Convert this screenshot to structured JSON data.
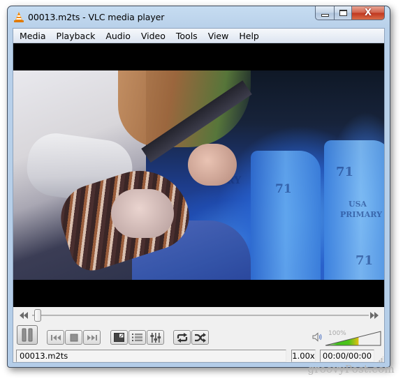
{
  "window": {
    "title": "00013.m2ts - VLC media player",
    "app_icon": "vlc-cone-icon",
    "controls": {
      "minimize_icon": "minimize-icon",
      "maximize_icon": "maximize-icon",
      "close_icon": "close-icon",
      "close_glyph": "X"
    }
  },
  "menubar": {
    "items": [
      {
        "label": "Media"
      },
      {
        "label": "Playback"
      },
      {
        "label": "Audio"
      },
      {
        "label": "Video"
      },
      {
        "label": "Tools"
      },
      {
        "label": "View"
      },
      {
        "label": "Help"
      }
    ]
  },
  "video": {
    "description": "Guitarist playing electric guitar on stage under blue light",
    "amp_labels": [
      "71",
      "71",
      "USA",
      "PRIMARY",
      "71",
      "RY"
    ]
  },
  "seekbar": {
    "position": 0.0,
    "back_icon": "seek-backward-icon",
    "forward_icon": "seek-forward-icon"
  },
  "controls": {
    "buttons": [
      {
        "name": "pause",
        "icon": "pause-icon"
      },
      {
        "name": "previous",
        "icon": "previous-icon"
      },
      {
        "name": "stop",
        "icon": "stop-icon"
      },
      {
        "name": "next",
        "icon": "next-icon"
      },
      {
        "name": "fullscreen",
        "icon": "fullscreen-icon"
      },
      {
        "name": "playlist",
        "icon": "playlist-icon"
      },
      {
        "name": "extended-settings",
        "icon": "equalizer-icon"
      },
      {
        "name": "loop",
        "icon": "loop-icon"
      },
      {
        "name": "random",
        "icon": "shuffle-icon"
      }
    ]
  },
  "volume": {
    "label": "100%",
    "level": 1.0,
    "icon": "speaker-icon"
  },
  "statusbar": {
    "filename": "00013.m2ts",
    "speed": "1.00x",
    "time": "00:00/00:00"
  },
  "watermark": "groovyPost.com",
  "colors": {
    "vlc_orange": "#f58a00",
    "volume_green": "#3fc21a",
    "volume_yellow": "#e2c012",
    "titlebar": "#b9d1ea",
    "close_red": "#c8452c"
  }
}
